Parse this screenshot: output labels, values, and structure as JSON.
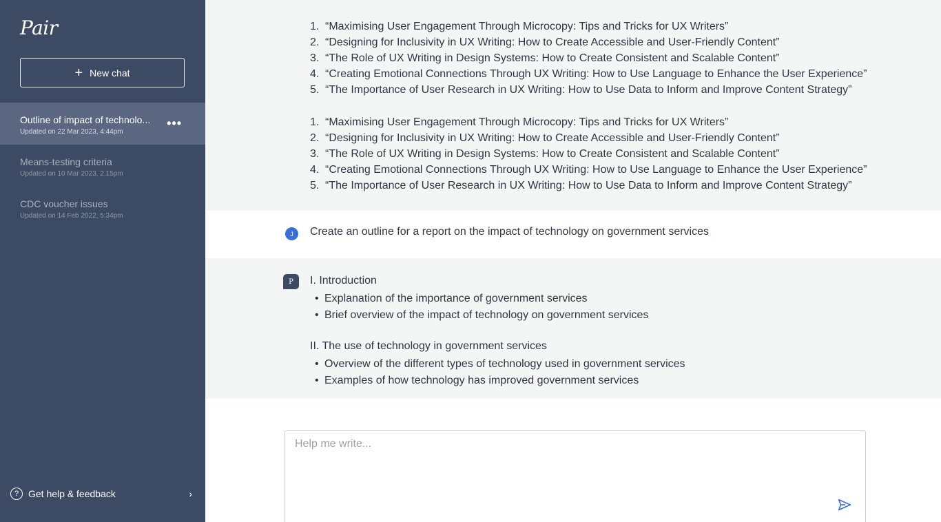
{
  "sidebar": {
    "logo": "Pair",
    "new_chat_label": "New chat",
    "chats": [
      {
        "title": "Outline of impact of technolo...",
        "date": "Updated on 22 Mar 2023, 4:44pm"
      },
      {
        "title": "Means-testing criteria",
        "date": "Updated on 10 Mar 2023, 2:15pm"
      },
      {
        "title": "CDC voucher issues",
        "date": "Updated on 14 Feb 2022, 5:34pm"
      }
    ],
    "more_glyph": "•••",
    "help_label": "Get help & feedback"
  },
  "conversation": {
    "list_a": [
      "“Maximising User Engagement Through Microcopy: Tips and Tricks for UX Writers”",
      "“Designing for Inclusivity in UX Writing: How to Create Accessible and User-Friendly Content”",
      "“The Role of UX Writing in Design Systems: How to Create Consistent and Scalable Content”",
      "“Creating Emotional Connections Through UX Writing: How to Use Language to Enhance the User Experience”",
      "“The Importance of User Research in UX Writing: How to Use Data to Inform and Improve Content Strategy”"
    ],
    "list_b": [
      "“Maximising User Engagement Through Microcopy: Tips and Tricks for UX Writers”",
      "“Designing for Inclusivity in UX Writing: How to Create Accessible and User-Friendly Content”",
      "“The Role of UX Writing in Design Systems: How to Create Consistent and Scalable Content”",
      "“Creating Emotional Connections Through UX Writing: How to Use Language to Enhance the User Experience”",
      "“The Importance of User Research in UX Writing: How to Use Data to Inform and Improve Content Strategy”"
    ],
    "list_numbers": [
      "1.",
      "2.",
      "3.",
      "4.",
      "5."
    ],
    "user_avatar": "J",
    "user_message": "Create an outline for a report on the impact of technology on government services",
    "assistant_avatar": "P",
    "section1_heading": "I. Introduction",
    "section1_bullets": [
      "Explanation of the importance of government services",
      "Brief overview of the impact of technology on government services"
    ],
    "section2_heading": "II. The use of technology in government services",
    "section2_bullets": [
      "Overview of the different types of technology used in government services",
      "Examples of how technology has improved government services"
    ]
  },
  "composer": {
    "placeholder": "Help me write..."
  },
  "colors": {
    "sidebar_bg": "#3d4a63",
    "active_item_bg": "#5b6781",
    "accent_blue": "#3a6fd8"
  }
}
